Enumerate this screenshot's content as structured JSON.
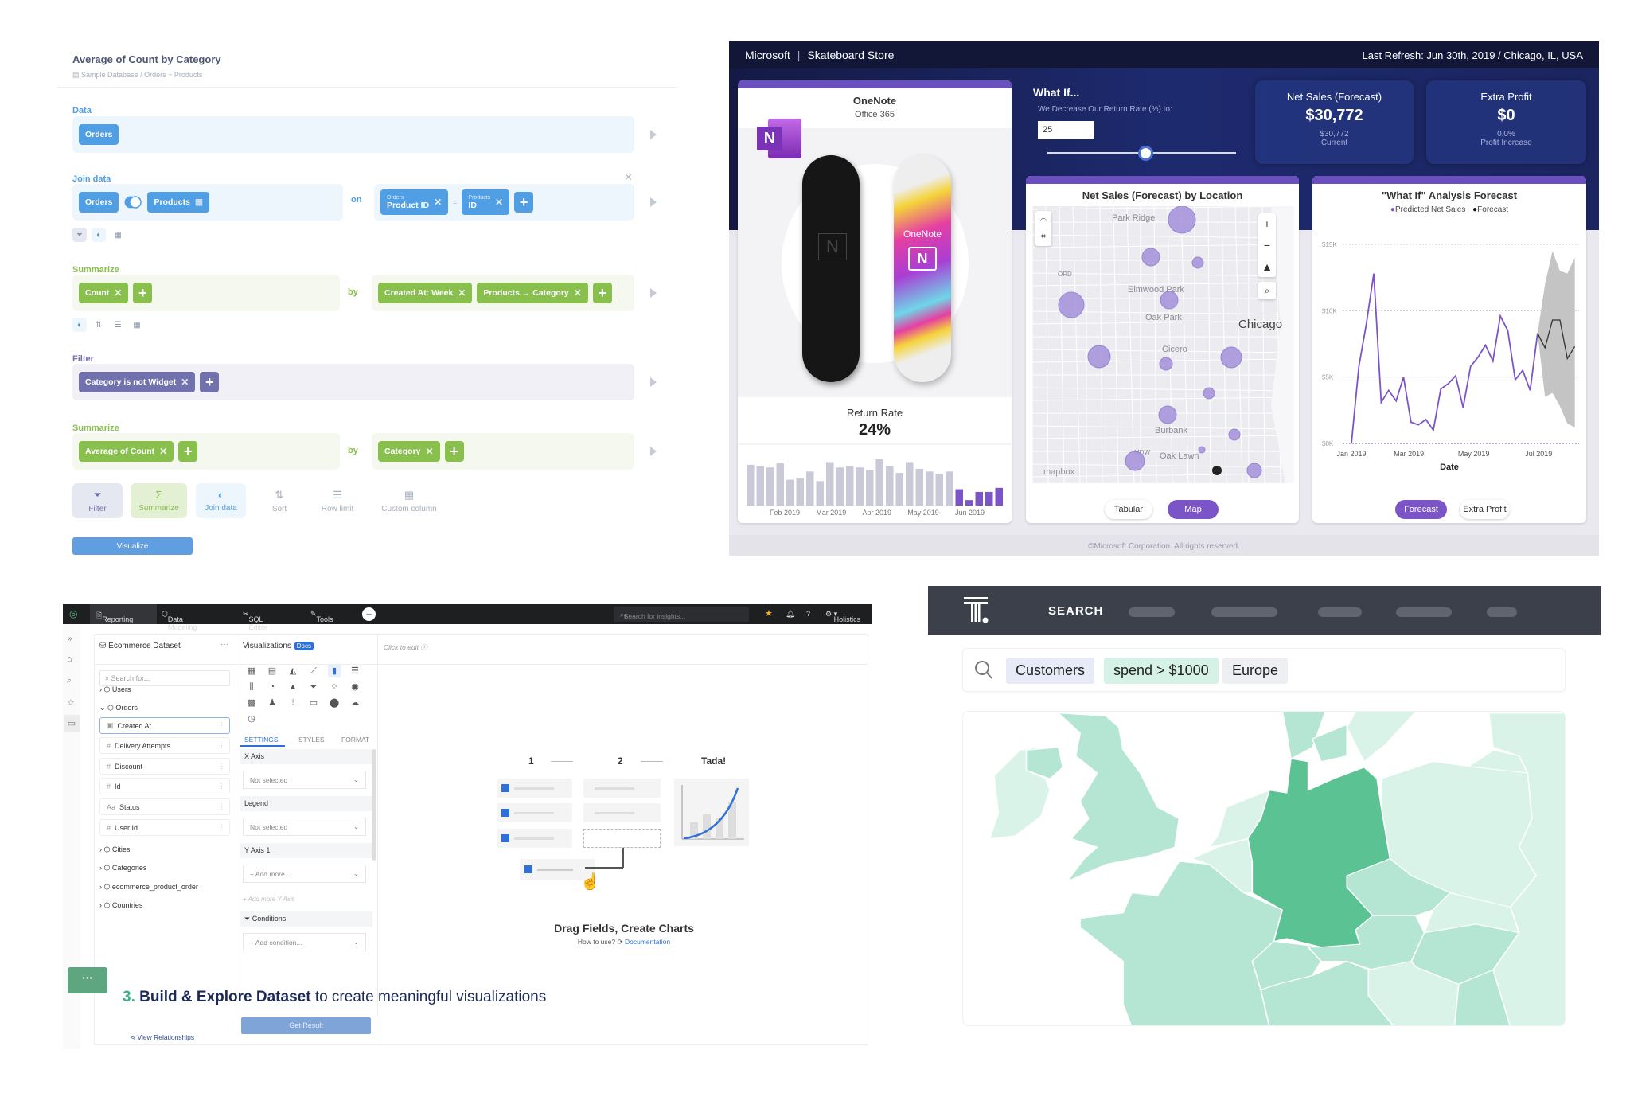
{
  "metabase": {
    "title": "Average of Count by Category",
    "breadcrumb": [
      "Sample Database",
      "/",
      "Orders + Products"
    ],
    "colors": {
      "data": "#509ee3",
      "summarize": "#88bf4d",
      "filter": "#7172ad"
    },
    "data": {
      "label": "Data",
      "table": "Orders"
    },
    "join": {
      "label": "Join data",
      "left": "Orders",
      "right": "Products",
      "on": "on",
      "left_key_table": "Orders",
      "left_key": "Product ID",
      "equals": "=",
      "right_key_table": "Products",
      "right_key": "ID"
    },
    "summarize1": {
      "label": "Summarize",
      "metrics": [
        "Count"
      ],
      "by": "by",
      "groups": [
        "Created At: Week",
        "Products → Category"
      ]
    },
    "filter": {
      "label": "Filter",
      "filters": [
        "Category is not Widget"
      ]
    },
    "summarize2": {
      "label": "Summarize",
      "metrics": [
        "Average of Count"
      ],
      "by": "by",
      "groups": [
        "Category"
      ]
    },
    "actions": [
      {
        "label": "Filter",
        "icon": "filter-icon"
      },
      {
        "label": "Summarize",
        "icon": "sigma-icon"
      },
      {
        "label": "Join data",
        "icon": "join-icon"
      },
      {
        "label": "Sort",
        "icon": "sort-icon"
      },
      {
        "label": "Row limit",
        "icon": "list-icon"
      },
      {
        "label": "Custom column",
        "icon": "add-column-icon"
      }
    ],
    "visualize": "Visualize"
  },
  "powerbi": {
    "brand": "Microsoft",
    "app": "Skateboard Store",
    "refresh": "Last Refresh: Jun 30th, 2019 / Chicago, IL, USA",
    "product": {
      "name": "OneNote",
      "suite": "Office 365",
      "board_text": "OneNote",
      "logo_letter": "N"
    },
    "return_rate": {
      "label": "Return Rate",
      "value": "24%"
    },
    "bars": {
      "values": [
        30,
        29,
        28,
        31,
        19,
        20,
        25,
        18,
        32,
        28,
        29,
        28,
        26,
        34,
        29,
        24,
        32,
        27,
        25,
        23,
        25,
        12,
        4,
        10,
        10,
        13
      ],
      "highlight_from": 21,
      "labels": [
        "Feb 2019",
        "Mar 2019",
        "Apr 2019",
        "May 2019",
        "Jun 2019"
      ],
      "colors": {
        "base": "#c9c9d8",
        "highlight": "#7b55c7"
      }
    },
    "whatif": {
      "title": "What If...",
      "prompt": "We Decrease Our Return Rate (%) to:",
      "value": "25",
      "slider_fraction": 0.52
    },
    "net_sales": {
      "title": "Net Sales (Forecast)",
      "value": "$30,772",
      "sub_value": "$30,772",
      "sub_label": "Current"
    },
    "extra_profit": {
      "title": "Extra Profit",
      "value": "$0",
      "sub_value": "0.0%",
      "sub_label": "Profit Increase"
    },
    "map": {
      "title": "Net Sales (Forecast) by Location",
      "places": [
        "Park Ridge",
        "Elmwood Park",
        "Oak Park",
        "Chicago",
        "Cicero",
        "Burbank",
        "Oak Lawn",
        "ORD",
        "MDW"
      ],
      "attribution": "mapbox",
      "tabs": [
        "Tabular",
        "Map"
      ],
      "active_tab": "Map"
    },
    "forecast": {
      "tabs": [
        "Forecast",
        "Extra Profit"
      ],
      "active_tab": "Forecast"
    },
    "footer": "©Microsoft Corporation. All rights reserved.",
    "accent": "#6b4fbf"
  },
  "chart_data": {
    "type": "line",
    "title": "\"What If\" Analysis Forecast",
    "xlabel": "Date",
    "ylabel": "",
    "legend": [
      "Predicted Net Sales",
      "Forecast"
    ],
    "legend_placement": "top",
    "yticks": [
      "$0K",
      "$5K",
      "$10K",
      "$15K"
    ],
    "ylim": [
      0,
      15000
    ],
    "xticks": [
      {
        "label": "Jan 2019",
        "date": "2019-01-06"
      },
      {
        "label": "Mar 2019",
        "date": "2019-03-01"
      },
      {
        "label": "May 2019",
        "date": "2019-05-01"
      },
      {
        "label": "Jul 2019",
        "date": "2019-07-01"
      }
    ],
    "xlim": [
      "2019-01-06",
      "2019-08-08"
    ],
    "grid": true,
    "series": [
      {
        "name": "Predicted Net Sales",
        "color": "#7b55c7",
        "x": [
          "2019-01-06",
          "2019-01-13",
          "2019-01-20",
          "2019-01-27",
          "2019-02-03",
          "2019-02-10",
          "2019-02-17",
          "2019-02-24",
          "2019-03-03",
          "2019-03-10",
          "2019-03-17",
          "2019-03-24",
          "2019-03-31",
          "2019-04-07",
          "2019-04-14",
          "2019-04-21",
          "2019-04-28",
          "2019-05-05",
          "2019-05-12",
          "2019-05-19",
          "2019-05-26",
          "2019-06-02",
          "2019-06-09",
          "2019-06-16",
          "2019-06-23",
          "2019-06-30"
        ],
        "y": [
          0,
          5800,
          9000,
          12800,
          3100,
          4000,
          3200,
          5000,
          1600,
          1400,
          1800,
          1000,
          4100,
          4500,
          5100,
          2700,
          5800,
          6500,
          7400,
          6200,
          9600,
          8500,
          4800,
          5500,
          4000,
          8300
        ]
      },
      {
        "name": "Forecast",
        "color": "#333333",
        "x": [
          "2019-06-30",
          "2019-07-07",
          "2019-07-14",
          "2019-07-21",
          "2019-07-28",
          "2019-08-04"
        ],
        "y": [
          8300,
          7200,
          9300,
          9300,
          6400,
          7300
        ],
        "band_low": [
          8300,
          3500,
          3800,
          2800,
          1500,
          1200
        ],
        "band_high": [
          8300,
          12000,
          14500,
          13000,
          12800,
          14000
        ]
      }
    ]
  },
  "holistics": {
    "nav": [
      "Reporting",
      "Data Modeling",
      "SQL Editor",
      "Tools"
    ],
    "search_placeholder": "Search for insights...",
    "user": "Holistics",
    "dataset": "Ecommerce Dataset",
    "field_search_placeholder": "Search for...",
    "models_top": [
      "Users",
      "Orders"
    ],
    "fields": [
      {
        "type": "date",
        "label": "Created At"
      },
      {
        "type": "#",
        "label": "Delivery Attempts"
      },
      {
        "type": "#",
        "label": "Discount"
      },
      {
        "type": "#",
        "label": "Id"
      },
      {
        "type": "Aa",
        "label": "Status"
      },
      {
        "type": "#",
        "label": "User Id"
      }
    ],
    "models_bottom": [
      "Cities",
      "Categories",
      "ecommerce_product_order",
      "Countries"
    ],
    "viz_title": "Visualizations",
    "docs": "Docs",
    "viz_icons": [
      "table-icon",
      "pivot-icon",
      "area-chart-icon",
      "line-chart-icon",
      "column-chart-icon",
      "bar-chart-icon",
      "combo-chart-icon",
      "pie-chart-icon",
      "pyramid-icon",
      "funnel-icon",
      "scatter-icon",
      "bubble-icon",
      "heatmap-icon",
      "person-icon",
      "waterfall-icon",
      "kpi-icon",
      "map-pin-icon",
      "cloud-icon",
      "gauge-icon"
    ],
    "tabs": [
      "SETTINGS",
      "STYLES",
      "FORMAT"
    ],
    "x_axis": "X Axis",
    "legend": "Legend",
    "y_axis": "Y Axis 1",
    "not_selected": "Not selected",
    "add_more": "+ Add more...",
    "add_more_y": "+ Add more Y Axis",
    "conditions": "Conditions",
    "add_condition": "+ Add condition...",
    "click_to_edit": "Click to edit",
    "steps": [
      "1",
      "2",
      "Tada!"
    ],
    "empty_title": "Drag Fields, Create Charts",
    "how_to": "How to use?",
    "docs_link": "Documentation",
    "caption_num": "3.",
    "caption_bold": "Build & Explore Dataset",
    "caption_rest": "to create meaningful visualizations",
    "get_result": "Get Result",
    "view_relationships": "View Relationships",
    "accent": "#2e6fd8"
  },
  "thoughtspot": {
    "nav": "SEARCH",
    "tokens": [
      "Customers",
      "spend > $1000",
      "Europe"
    ],
    "map_colors": {
      "high": "#5bc393",
      "mid": "#b5e6d3",
      "low": "#daf3e9"
    }
  }
}
